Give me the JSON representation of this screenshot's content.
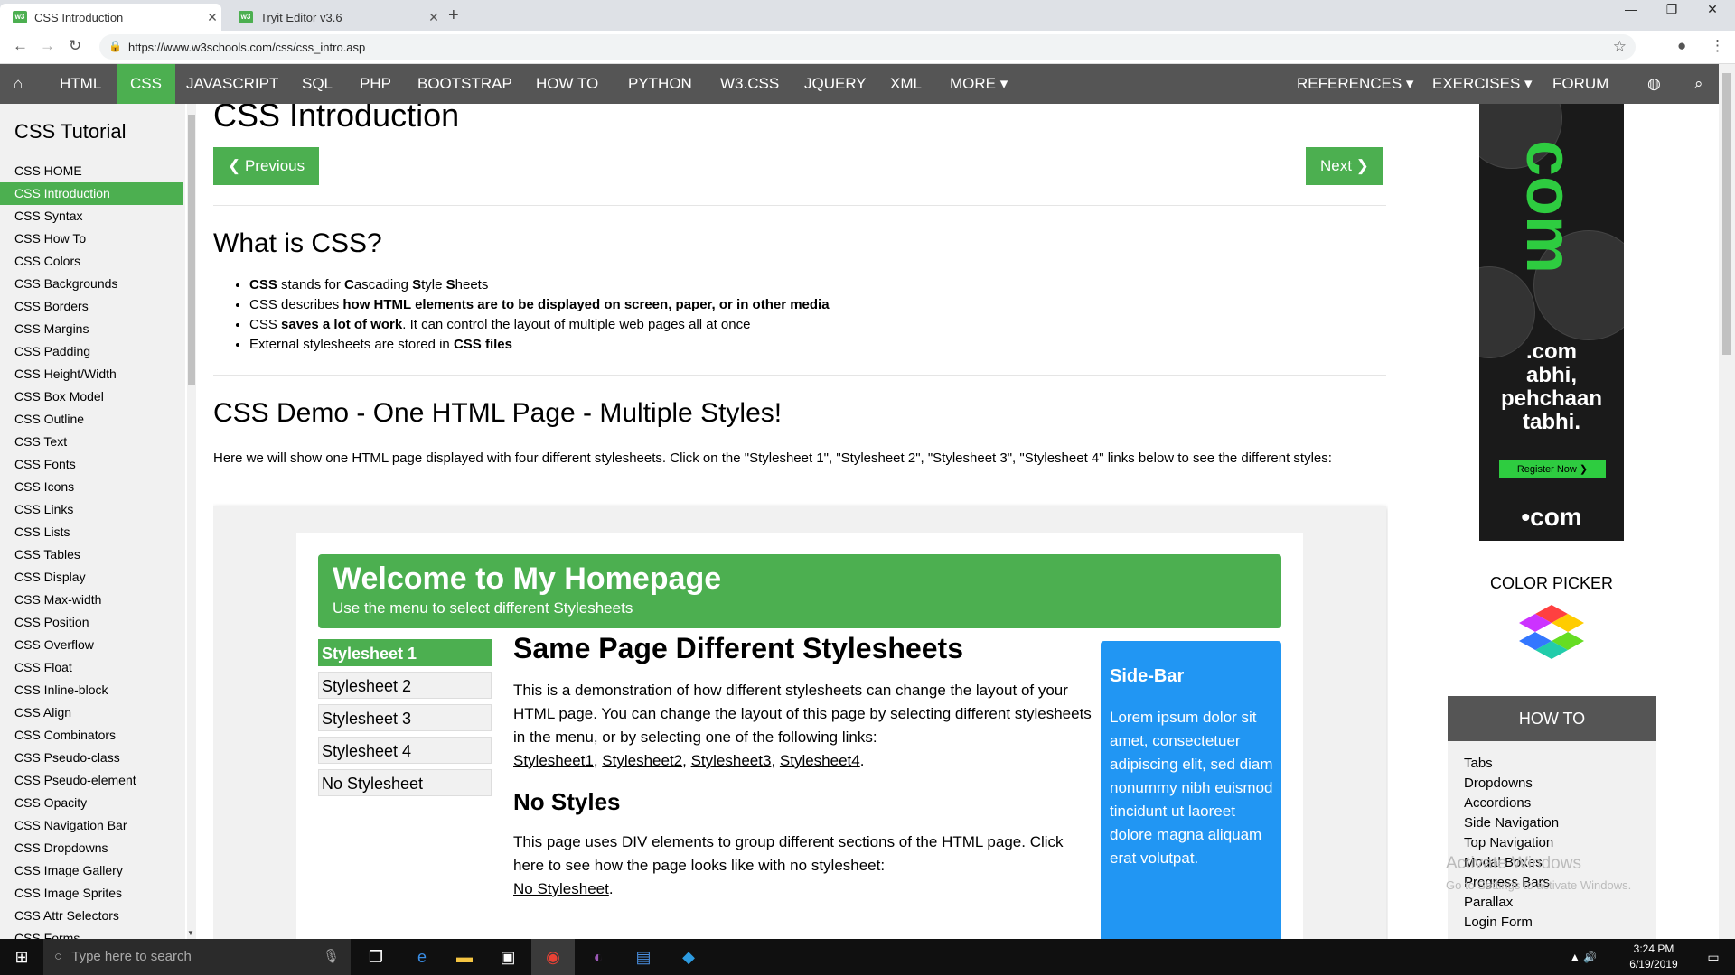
{
  "browser": {
    "tabs": [
      {
        "label": "CSS Introduction",
        "favicon": "w3"
      },
      {
        "label": "Tryit Editor v3.6",
        "favicon": "w3"
      }
    ],
    "url": "https://www.w3schools.com/css/css_intro.asp"
  },
  "w3nav": {
    "items": [
      "HTML",
      "CSS",
      "JAVASCRIPT",
      "SQL",
      "PHP",
      "BOOTSTRAP",
      "HOW TO",
      "PYTHON",
      "W3.CSS",
      "JQUERY",
      "XML",
      "MORE ▾"
    ],
    "right_items": [
      "REFERENCES ▾",
      "EXERCISES ▾",
      "FORUM"
    ],
    "active": "CSS"
  },
  "sidebar": {
    "title": "CSS Tutorial",
    "items": [
      "CSS HOME",
      "CSS Introduction",
      "CSS Syntax",
      "CSS How To",
      "CSS Colors",
      "CSS Backgrounds",
      "CSS Borders",
      "CSS Margins",
      "CSS Padding",
      "CSS Height/Width",
      "CSS Box Model",
      "CSS Outline",
      "CSS Text",
      "CSS Fonts",
      "CSS Icons",
      "CSS Links",
      "CSS Lists",
      "CSS Tables",
      "CSS Display",
      "CSS Max-width",
      "CSS Position",
      "CSS Overflow",
      "CSS Float",
      "CSS Inline-block",
      "CSS Align",
      "CSS Combinators",
      "CSS Pseudo-class",
      "CSS Pseudo-element",
      "CSS Opacity",
      "CSS Navigation Bar",
      "CSS Dropdowns",
      "CSS Image Gallery",
      "CSS Image Sprites",
      "CSS Attr Selectors",
      "CSS Forms"
    ],
    "active_index": 1
  },
  "main": {
    "title": "CSS Introduction",
    "prev_label": "❮ Previous",
    "next_label": "Next ❯",
    "what_heading": "What is CSS?",
    "demo_heading": "CSS Demo - One HTML Page - Multiple Styles!",
    "demo_para": "Here we will show one HTML page displayed with four different stylesheets. Click on the \"Stylesheet 1\", \"Stylesheet 2\", \"Stylesheet 3\", \"Stylesheet 4\" links below to see the different styles:"
  },
  "demo": {
    "header_title": "Welcome to My Homepage",
    "header_sub": "Use the menu to select different Stylesheets",
    "menu": [
      "Stylesheet 1",
      "Stylesheet 2",
      "Stylesheet 3",
      "Stylesheet 4",
      "No Stylesheet"
    ],
    "main_heading": "Same Page Different Stylesheets",
    "main_text": "This is a demonstration of how different stylesheets can change the layout of your HTML page. You can change the layout of this page by selecting different stylesheets in the menu, or by selecting one of the following links:",
    "links": [
      "Stylesheet1",
      "Stylesheet2",
      "Stylesheet3",
      "Stylesheet4"
    ],
    "nostyle_heading": "No Styles",
    "nostyle_text": "This page uses DIV elements to group different sections of the HTML page. Click here to see how the page looks like with no stylesheet:",
    "nostyle_link": "No Stylesheet",
    "side_title": "Side-Bar",
    "side_text": "Lorem ipsum dolor sit amet, consectetuer adipiscing elit, sed diam nonummy nibh euismod tincidunt ut laoreet dolore magna aliquam erat volutpat."
  },
  "ad": {
    "com": "com",
    "line1": ".com",
    "line2": "abhi,",
    "line3": "pehchaan",
    "line4": "tabhi.",
    "register": "Register Now",
    "logo": "•com"
  },
  "right": {
    "color_picker": "COLOR PICKER",
    "howto_title": "HOW TO",
    "howto_items": [
      "Tabs",
      "Dropdowns",
      "Accordions",
      "Side Navigation",
      "Top Navigation",
      "Modal Boxes",
      "Progress Bars",
      "Parallax",
      "Login Form"
    ]
  },
  "watermark": {
    "line1": "Activate Windows",
    "line2": "Go to Settings to activate Windows."
  },
  "taskbar": {
    "search_placeholder": "Type here to search",
    "time": "3:24 PM",
    "date": "6/19/2019"
  },
  "colors": {
    "w3green": "#4CAF50",
    "navgray": "#555555",
    "sidebarblue": "#2196F3"
  }
}
